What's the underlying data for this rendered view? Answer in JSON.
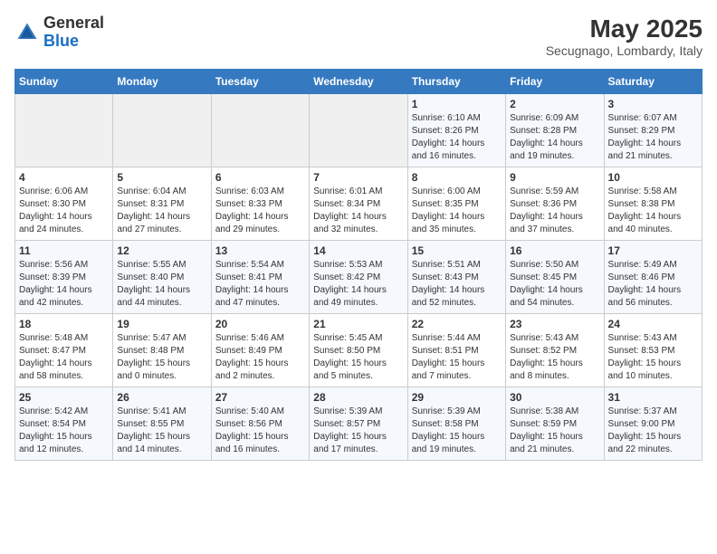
{
  "header": {
    "logo_general": "General",
    "logo_blue": "Blue",
    "month_year": "May 2025",
    "location": "Secugnago, Lombardy, Italy"
  },
  "days_of_week": [
    "Sunday",
    "Monday",
    "Tuesday",
    "Wednesday",
    "Thursday",
    "Friday",
    "Saturday"
  ],
  "weeks": [
    [
      {
        "day": "",
        "info": ""
      },
      {
        "day": "",
        "info": ""
      },
      {
        "day": "",
        "info": ""
      },
      {
        "day": "",
        "info": ""
      },
      {
        "day": "1",
        "info": "Sunrise: 6:10 AM\nSunset: 8:26 PM\nDaylight: 14 hours\nand 16 minutes."
      },
      {
        "day": "2",
        "info": "Sunrise: 6:09 AM\nSunset: 8:28 PM\nDaylight: 14 hours\nand 19 minutes."
      },
      {
        "day": "3",
        "info": "Sunrise: 6:07 AM\nSunset: 8:29 PM\nDaylight: 14 hours\nand 21 minutes."
      }
    ],
    [
      {
        "day": "4",
        "info": "Sunrise: 6:06 AM\nSunset: 8:30 PM\nDaylight: 14 hours\nand 24 minutes."
      },
      {
        "day": "5",
        "info": "Sunrise: 6:04 AM\nSunset: 8:31 PM\nDaylight: 14 hours\nand 27 minutes."
      },
      {
        "day": "6",
        "info": "Sunrise: 6:03 AM\nSunset: 8:33 PM\nDaylight: 14 hours\nand 29 minutes."
      },
      {
        "day": "7",
        "info": "Sunrise: 6:01 AM\nSunset: 8:34 PM\nDaylight: 14 hours\nand 32 minutes."
      },
      {
        "day": "8",
        "info": "Sunrise: 6:00 AM\nSunset: 8:35 PM\nDaylight: 14 hours\nand 35 minutes."
      },
      {
        "day": "9",
        "info": "Sunrise: 5:59 AM\nSunset: 8:36 PM\nDaylight: 14 hours\nand 37 minutes."
      },
      {
        "day": "10",
        "info": "Sunrise: 5:58 AM\nSunset: 8:38 PM\nDaylight: 14 hours\nand 40 minutes."
      }
    ],
    [
      {
        "day": "11",
        "info": "Sunrise: 5:56 AM\nSunset: 8:39 PM\nDaylight: 14 hours\nand 42 minutes."
      },
      {
        "day": "12",
        "info": "Sunrise: 5:55 AM\nSunset: 8:40 PM\nDaylight: 14 hours\nand 44 minutes."
      },
      {
        "day": "13",
        "info": "Sunrise: 5:54 AM\nSunset: 8:41 PM\nDaylight: 14 hours\nand 47 minutes."
      },
      {
        "day": "14",
        "info": "Sunrise: 5:53 AM\nSunset: 8:42 PM\nDaylight: 14 hours\nand 49 minutes."
      },
      {
        "day": "15",
        "info": "Sunrise: 5:51 AM\nSunset: 8:43 PM\nDaylight: 14 hours\nand 52 minutes."
      },
      {
        "day": "16",
        "info": "Sunrise: 5:50 AM\nSunset: 8:45 PM\nDaylight: 14 hours\nand 54 minutes."
      },
      {
        "day": "17",
        "info": "Sunrise: 5:49 AM\nSunset: 8:46 PM\nDaylight: 14 hours\nand 56 minutes."
      }
    ],
    [
      {
        "day": "18",
        "info": "Sunrise: 5:48 AM\nSunset: 8:47 PM\nDaylight: 14 hours\nand 58 minutes."
      },
      {
        "day": "19",
        "info": "Sunrise: 5:47 AM\nSunset: 8:48 PM\nDaylight: 15 hours\nand 0 minutes."
      },
      {
        "day": "20",
        "info": "Sunrise: 5:46 AM\nSunset: 8:49 PM\nDaylight: 15 hours\nand 2 minutes."
      },
      {
        "day": "21",
        "info": "Sunrise: 5:45 AM\nSunset: 8:50 PM\nDaylight: 15 hours\nand 5 minutes."
      },
      {
        "day": "22",
        "info": "Sunrise: 5:44 AM\nSunset: 8:51 PM\nDaylight: 15 hours\nand 7 minutes."
      },
      {
        "day": "23",
        "info": "Sunrise: 5:43 AM\nSunset: 8:52 PM\nDaylight: 15 hours\nand 8 minutes."
      },
      {
        "day": "24",
        "info": "Sunrise: 5:43 AM\nSunset: 8:53 PM\nDaylight: 15 hours\nand 10 minutes."
      }
    ],
    [
      {
        "day": "25",
        "info": "Sunrise: 5:42 AM\nSunset: 8:54 PM\nDaylight: 15 hours\nand 12 minutes."
      },
      {
        "day": "26",
        "info": "Sunrise: 5:41 AM\nSunset: 8:55 PM\nDaylight: 15 hours\nand 14 minutes."
      },
      {
        "day": "27",
        "info": "Sunrise: 5:40 AM\nSunset: 8:56 PM\nDaylight: 15 hours\nand 16 minutes."
      },
      {
        "day": "28",
        "info": "Sunrise: 5:39 AM\nSunset: 8:57 PM\nDaylight: 15 hours\nand 17 minutes."
      },
      {
        "day": "29",
        "info": "Sunrise: 5:39 AM\nSunset: 8:58 PM\nDaylight: 15 hours\nand 19 minutes."
      },
      {
        "day": "30",
        "info": "Sunrise: 5:38 AM\nSunset: 8:59 PM\nDaylight: 15 hours\nand 21 minutes."
      },
      {
        "day": "31",
        "info": "Sunrise: 5:37 AM\nSunset: 9:00 PM\nDaylight: 15 hours\nand 22 minutes."
      }
    ]
  ]
}
